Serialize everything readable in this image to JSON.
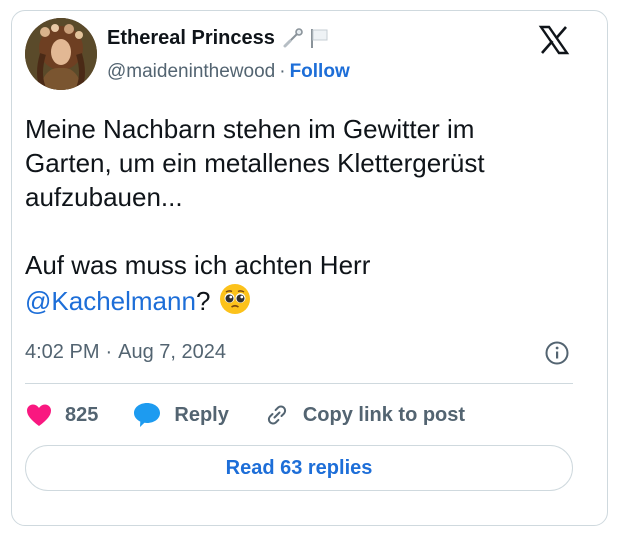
{
  "author": {
    "display_name": "Ethereal Princess",
    "handle": "@maideninthewood",
    "separator": "·",
    "follow_label": "Follow",
    "badges": [
      "safety-pin-icon",
      "white-flag-icon"
    ]
  },
  "tweet": {
    "line1": "Meine Nachbarn stehen im Gewitter im",
    "line2": "Garten, um ein metallenes Klettergerüst",
    "line3": "aufzubauen...",
    "line4_prefix": "Auf was muss ich achten Herr",
    "mention": "@Kachelmann",
    "suffix": "?",
    "emoji": "pleading-face-emoji"
  },
  "meta": {
    "time": "4:02 PM",
    "separator": "·",
    "date": "Aug 7, 2024"
  },
  "actions": {
    "likes_count": "825",
    "reply_label": "Reply",
    "copy_label": "Copy link to post"
  },
  "replies_button": "Read 63 replies",
  "colors": {
    "accent": "#1d6ed8",
    "heart": "#f91880",
    "reply_bubble": "#1d9bf0",
    "muted": "#536471",
    "border": "#cfd9de"
  }
}
